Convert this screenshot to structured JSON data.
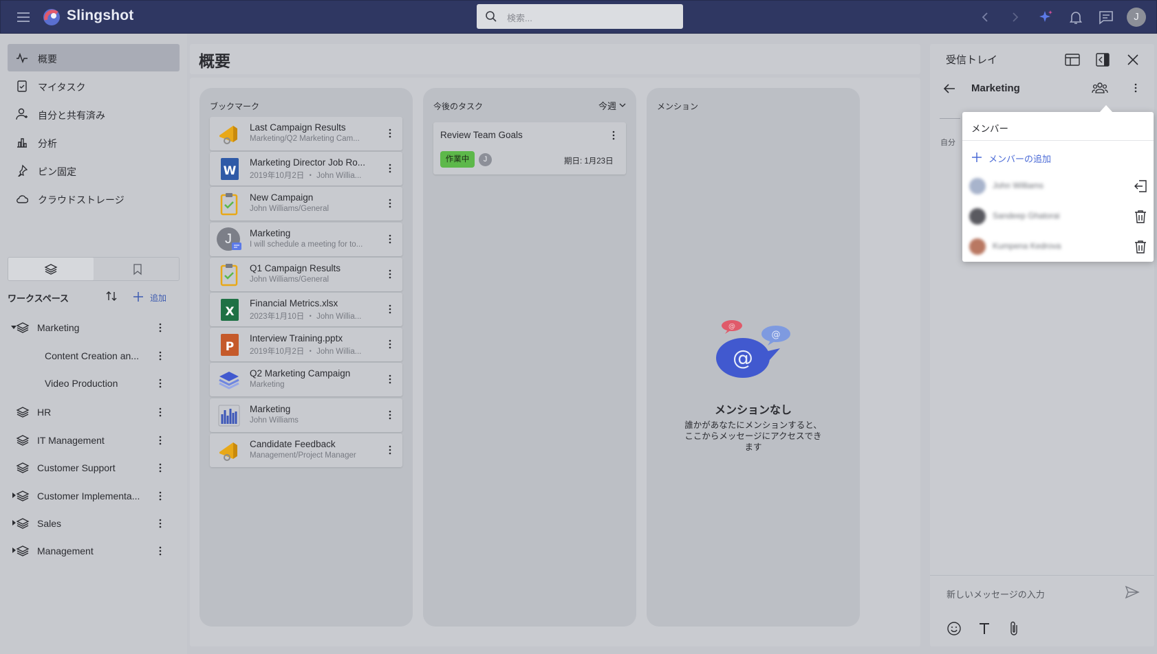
{
  "topbar": {
    "brand": "Slingshot",
    "search_placeholder": "検索...",
    "avatar_initial": "J"
  },
  "sidebar": {
    "nav": [
      {
        "label": "概要",
        "icon": "activity-icon",
        "active": true
      },
      {
        "label": "マイタスク",
        "icon": "task-clipboard-icon"
      },
      {
        "label": "自分と共有済み",
        "icon": "shared-user-icon"
      },
      {
        "label": "分析",
        "icon": "bar-chart-icon"
      },
      {
        "label": "ピン固定",
        "icon": "pin-icon"
      },
      {
        "label": "クラウドストレージ",
        "icon": "cloud-icon"
      }
    ],
    "workspace_title": "ワークスペース",
    "add_label": "追加",
    "workspaces": [
      {
        "label": "Marketing",
        "level": 0,
        "caret": "expanded",
        "icon": true
      },
      {
        "label": "Content Creation an...",
        "level": 1,
        "caret": "none",
        "icon": false
      },
      {
        "label": "Video Production",
        "level": 1,
        "caret": "none",
        "icon": false
      },
      {
        "label": "HR",
        "level": 0,
        "caret": "none",
        "icon": true
      },
      {
        "label": "IT Management",
        "level": 0,
        "caret": "none",
        "icon": true
      },
      {
        "label": "Customer Support",
        "level": 0,
        "caret": "none",
        "icon": true
      },
      {
        "label": "Customer Implementa...",
        "level": 0,
        "caret": "collapsed",
        "icon": true
      },
      {
        "label": "Sales",
        "level": 0,
        "caret": "collapsed",
        "icon": true
      },
      {
        "label": "Management",
        "level": 0,
        "caret": "collapsed",
        "icon": true
      }
    ]
  },
  "main": {
    "title": "概要",
    "bookmarks": {
      "title": "ブックマーク",
      "items": [
        {
          "title": "Last Campaign Results",
          "sub": "Marketing/Q2 Marketing Cam...",
          "icon": "megaphone"
        },
        {
          "title": "Marketing Director Job Ro...",
          "sub": "2019年10月2日 ・ John Willia...",
          "icon": "word"
        },
        {
          "title": "New Campaign",
          "sub": "John Williams/General",
          "icon": "clipboard"
        },
        {
          "title": "Marketing",
          "sub": "I will schedule a meeting for to...",
          "icon": "avatar",
          "avatar_initial": "J"
        },
        {
          "title": "Q1 Campaign Results",
          "sub": "John Williams/General",
          "icon": "clipboard"
        },
        {
          "title": "Financial Metrics.xlsx",
          "sub": "2023年1月10日 ・ John Willia...",
          "icon": "excel"
        },
        {
          "title": "Interview Training.pptx",
          "sub": "2019年10月2日 ・ John Willia...",
          "icon": "powerpoint"
        },
        {
          "title": "Q2 Marketing Campaign",
          "sub": "Marketing",
          "icon": "layers"
        },
        {
          "title": "Marketing",
          "sub": "John Williams",
          "icon": "dashboard"
        },
        {
          "title": "Candidate Feedback",
          "sub": "Management/Project Manager",
          "icon": "megaphone"
        }
      ]
    },
    "tasks": {
      "title": "今後のタスク",
      "filter": "今週",
      "items": [
        {
          "title": "Review Team Goals",
          "status": "作業中",
          "assignee": "J",
          "due": "期日: 1月23日"
        }
      ]
    },
    "mentions": {
      "title": "メンション",
      "empty_title": "メンションなし",
      "empty_desc": "誰かがあなたにメンションすると、ここからメッセージにアクセスできます"
    }
  },
  "inbox": {
    "title": "受信トレイ",
    "channel": "Marketing",
    "partial_label": "自分",
    "message_placeholder": "新しいメッセージの入力",
    "members_popup": {
      "title": "メンバー",
      "add_label": "メンバーの追加",
      "members": [
        {
          "name": "John Williams",
          "action": "leave"
        },
        {
          "name": "Sandeep Ghatorai",
          "action": "delete"
        },
        {
          "name": "Kumpena Kedrova",
          "action": "delete"
        }
      ]
    }
  },
  "colors": {
    "topbar": "#2f3762",
    "accent": "#3d5bb0",
    "status_green": "#5db84a",
    "overlay": "#c7c9ce"
  }
}
